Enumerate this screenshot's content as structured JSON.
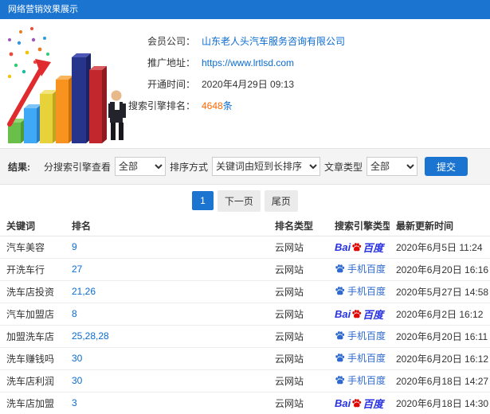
{
  "header": {
    "title": "网络营销效果展示"
  },
  "company": {
    "rows": [
      {
        "label": "会员公司：",
        "value": "山东老人头汽车服务咨询有限公司"
      },
      {
        "label": "推广地址：",
        "value": "https://www.lrtlsd.com"
      },
      {
        "label": "开通时间：",
        "value": "2020年4月29日 09:13"
      },
      {
        "label": "搜索引擎排名：",
        "value": "4648",
        "suffix": "条"
      }
    ]
  },
  "filters": {
    "section_label": "结果:",
    "engine_label": "分搜索引擎查看",
    "engine_value": "全部",
    "sort_label": "排序方式",
    "sort_value": "关键词由短到长排序",
    "type_label": "文章类型",
    "type_value": "全部",
    "submit_label": "提交"
  },
  "pagination": {
    "current": "1",
    "next": "下一页",
    "last": "尾页"
  },
  "table": {
    "headers": [
      "关键词",
      "排名",
      "排名类型",
      "搜索引擎类型",
      "最新更新时间"
    ],
    "rows": [
      {
        "keyword": "汽车美容",
        "rank": "9",
        "rank_type": "云网站",
        "engine": "baidu-pc",
        "updated": "2020年6月5日 11:24"
      },
      {
        "keyword": "开洗车行",
        "rank": "27",
        "rank_type": "云网站",
        "engine": "baidu-mobile",
        "updated": "2020年6月20日 16:16"
      },
      {
        "keyword": "洗车店投资",
        "rank": "21,26",
        "rank_type": "云网站",
        "engine": "baidu-mobile",
        "updated": "2020年5月27日 14:58"
      },
      {
        "keyword": "汽车加盟店",
        "rank": "8",
        "rank_type": "云网站",
        "engine": "baidu-pc",
        "updated": "2020年6月2日 16:12"
      },
      {
        "keyword": "加盟洗车店",
        "rank": "25,28,28",
        "rank_type": "云网站",
        "engine": "baidu-mobile",
        "updated": "2020年6月20日 16:11"
      },
      {
        "keyword": "洗车赚钱吗",
        "rank": "30",
        "rank_type": "云网站",
        "engine": "baidu-mobile",
        "updated": "2020年6月20日 16:12"
      },
      {
        "keyword": "洗车店利润",
        "rank": "30",
        "rank_type": "云网站",
        "engine": "baidu-mobile",
        "updated": "2020年6月18日 14:27"
      },
      {
        "keyword": "洗车店加盟",
        "rank": "3",
        "rank_type": "云网站",
        "engine": "baidu-pc",
        "updated": "2020年6月18日 14:30"
      }
    ]
  },
  "engine_logos": {
    "baidu_pc": {
      "bai": "Bai",
      "du": "百度"
    },
    "baidu_mobile": {
      "label": "手机百度"
    }
  },
  "colors": {
    "header_blue": "#1b74d0",
    "link_blue": "#0a6bd2",
    "highlight_orange": "#ff6600",
    "baidu_blue": "#2932e1",
    "baidu_red": "#e10601",
    "mobile_baidu_blue": "#2e6ad1"
  }
}
